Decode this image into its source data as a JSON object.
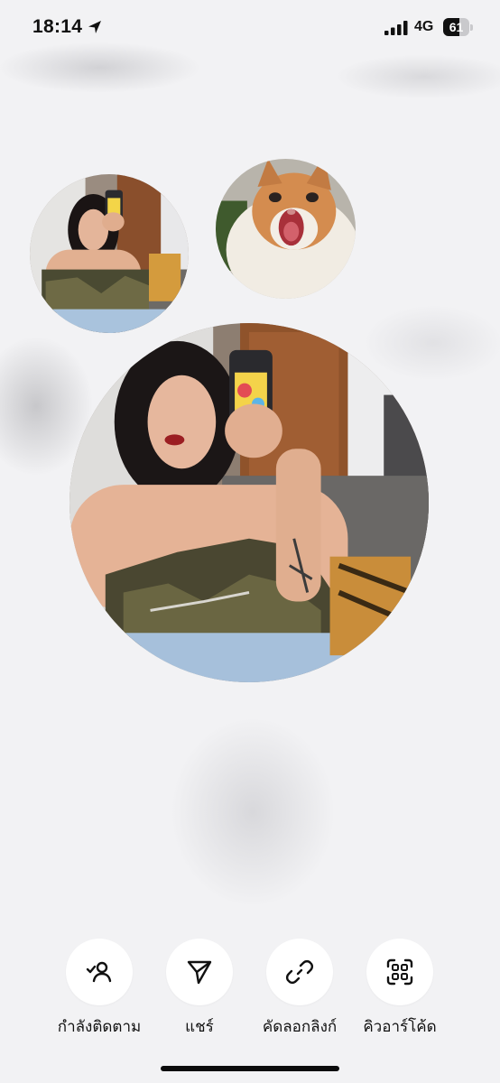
{
  "status_bar": {
    "time": "18:14",
    "network": "4G",
    "battery_level": "61",
    "icons": [
      "location-arrow-icon",
      "cellular-signal-icon",
      "battery-icon"
    ]
  },
  "avatars": {
    "small_1": {
      "description_icon": "profile-photo-portrait"
    },
    "small_2": {
      "description_icon": "profile-photo-cat"
    },
    "large": {
      "description_icon": "profile-photo-portrait"
    }
  },
  "actions": [
    {
      "label": "กำลังติดตาม",
      "icon": "person-check-icon"
    },
    {
      "label": "แชร์",
      "icon": "send-icon"
    },
    {
      "label": "คัดลอกลิงก์",
      "icon": "link-icon"
    },
    {
      "label": "คิวอาร์โค้ด",
      "icon": "qr-code-icon"
    }
  ],
  "colors": {
    "background": "#f2f2f4",
    "button_bg": "#ffffff",
    "text": "#111111"
  }
}
